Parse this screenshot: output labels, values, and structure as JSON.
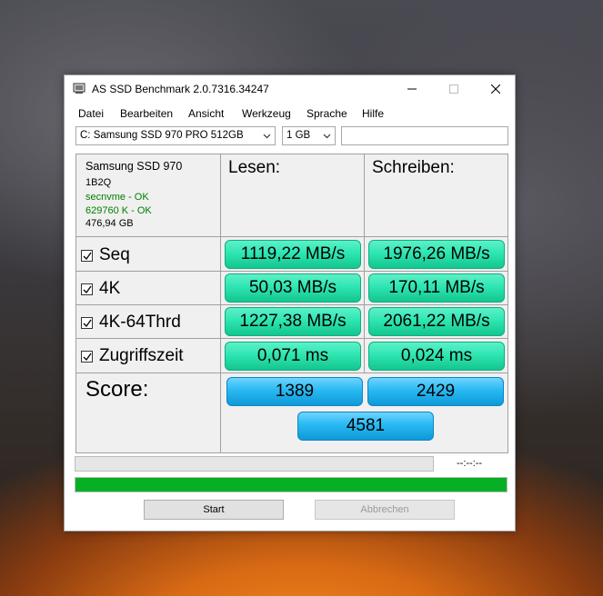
{
  "window": {
    "title": "AS SSD Benchmark 2.0.7316.34247"
  },
  "menu": [
    "Datei",
    "Bearbeiten",
    "Ansicht",
    "Werkzeug",
    "Sprache",
    "Hilfe"
  ],
  "toolbar": {
    "drive": "C: Samsung SSD 970 PRO 512GB",
    "size": "1 GB",
    "text_value": ""
  },
  "drive_info": {
    "model": "Samsung SSD 970",
    "firmware": "1B2Q",
    "driver": "secnvme - OK",
    "alignment": "629760 K - OK",
    "capacity": "476,94 GB"
  },
  "headers": {
    "read": "Lesen:",
    "write": "Schreiben:"
  },
  "rows": [
    {
      "label": "Seq",
      "read": "1119,22 MB/s",
      "write": "1976,26 MB/s"
    },
    {
      "label": "4K",
      "read": "50,03 MB/s",
      "write": "170,11 MB/s"
    },
    {
      "label": "4K-64Thrd",
      "read": "1227,38 MB/s",
      "write": "2061,22 MB/s"
    },
    {
      "label": "Zugriffszeit",
      "read": "0,071 ms",
      "write": "0,024 ms"
    }
  ],
  "score": {
    "label": "Score:",
    "read": "1389",
    "write": "2429",
    "total": "4581"
  },
  "progress": {
    "time": "--:--:--",
    "current": 0,
    "overall": 1.0
  },
  "buttons": {
    "start": "Start",
    "cancel": "Abbrechen"
  },
  "colors": {
    "result": "#2ee6b2",
    "score": "#28b9f2",
    "progress": "#06b025",
    "ok_text": "#008000"
  }
}
